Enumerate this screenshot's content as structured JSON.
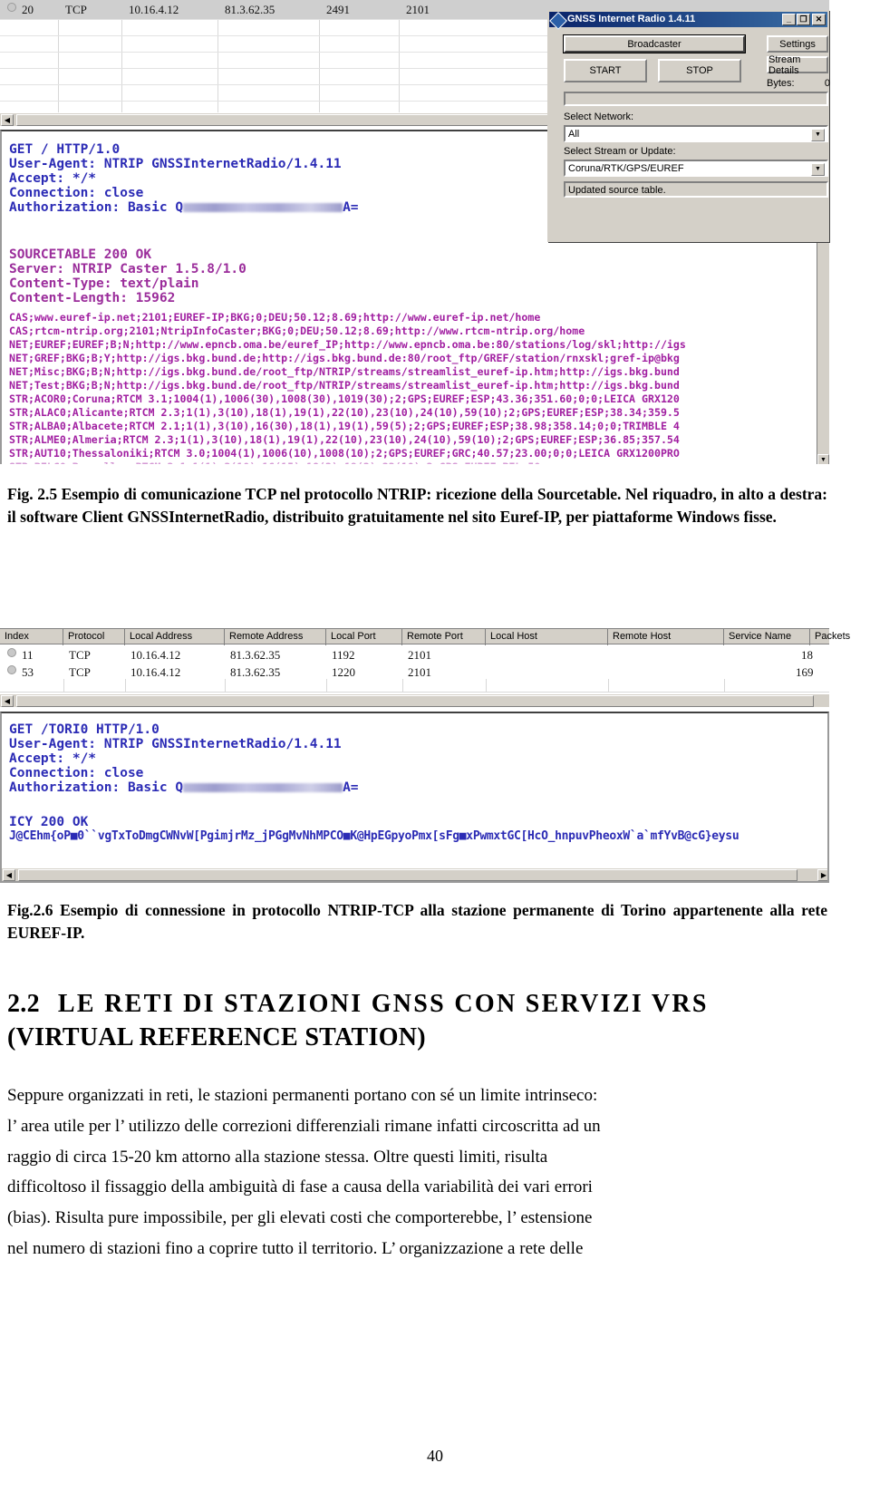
{
  "page": {
    "number": "40"
  },
  "figure1": {
    "connection_row": {
      "index": "20",
      "protocol": "TCP",
      "local_address": "10.16.4.12",
      "remote_address": "81.3.62.35",
      "local_port": "2491",
      "remote_port": "2101"
    },
    "terminal": {
      "request_lines": [
        "GET / HTTP/1.0",
        "User-Agent: NTRIP GNSSInternetRadio/1.4.11",
        "Accept: */*",
        "Connection: close"
      ],
      "auth_prefix": "Authorization: Basic Q",
      "auth_suffix": "A=",
      "response_lines": [
        "SOURCETABLE 200 OK",
        "Server: NTRIP Caster 1.5.8/1.0",
        "Content-Type: text/plain",
        "Content-Length: 15962"
      ],
      "sourcetable_lines": [
        "CAS;www.euref-ip.net;2101;EUREF-IP;BKG;0;DEU;50.12;8.69;http://www.euref-ip.net/home",
        "CAS;rtcm-ntrip.org;2101;NtripInfoCaster;BKG;0;DEU;50.12;8.69;http://www.rtcm-ntrip.org/home",
        "NET;EUREF;EUREF;B;N;http://www.epncb.oma.be/euref_IP;http://www.epncb.oma.be:80/stations/log/skl;http://igs",
        "NET;GREF;BKG;B;Y;http://igs.bkg.bund.de;http://igs.bkg.bund.de:80/root_ftp/GREF/station/rnxskl;gref-ip@bkg",
        "NET;Misc;BKG;B;N;http://igs.bkg.bund.de/root_ftp/NTRIP/streams/streamlist_euref-ip.htm;http://igs.bkg.bund",
        "NET;Test;BKG;B;N;http://igs.bkg.bund.de/root_ftp/NTRIP/streams/streamlist_euref-ip.htm;http://igs.bkg.bund",
        "STR;ACOR0;Coruna;RTCM 3.1;1004(1),1006(30),1008(30),1019(30);2;GPS;EUREF;ESP;43.36;351.60;0;0;LEICA GRX120",
        "STR;ALAC0;Alicante;RTCM 2.3;1(1),3(10),18(1),19(1),22(10),23(10),24(10),59(10);2;GPS;EUREF;ESP;38.34;359.5",
        "STR;ALBA0;Albacete;RTCM 2.1;1(1),3(10),16(30),18(1),19(1),59(5);2;GPS;EUREF;ESP;38.98;358.14;0;0;TRIMBLE 4",
        "STR;ALME0;Almeria;RTCM 2.3;1(1),3(10),18(1),19(1),22(10),23(10),24(10),59(10);2;GPS;EUREF;ESP;36.85;357.54",
        "STR;AUT10;Thessaloniki;RTCM 3.0;1004(1),1006(10),1008(10);2;GPS;EUREF;GRC;40.57;23.00;0;0;LEICA GRX1200PRO"
      ]
    },
    "gnss_window": {
      "title": "GNSS Internet Radio 1.4.11",
      "minimize_label": "_",
      "maximize_label": "❐",
      "close_label": "✕",
      "broadcaster_button": "Broadcaster",
      "settings_button": "Settings",
      "start_button": "START",
      "stop_button": "STOP",
      "stream_details_button": "Stream Details",
      "bytes_label": "Bytes:",
      "bytes_value": "0",
      "select_network_label": "Select Network:",
      "select_network_value": "All",
      "select_stream_label": "Select Stream or Update:",
      "select_stream_value": "Coruna/RTK/GPS/EUREF",
      "status_text": "Updated source table."
    }
  },
  "caption1": "Fig. 2.5 Esempio di comunicazione TCP nel protocollo NTRIP: ricezione della Sourcetable. Nel riquadro, in alto a destra: il software Client GNSSInternetRadio, distribuito gratuitamente nel sito Euref-IP, per piattaforme Windows fisse.",
  "figure2": {
    "columns": [
      "Index",
      "Protocol",
      "Local Address",
      "Remote Address",
      "Local Port",
      "Remote Port",
      "Local Host",
      "Remote Host",
      "Service Name",
      "Packets"
    ],
    "rows": [
      {
        "index": "11",
        "protocol": "TCP",
        "local_address": "10.16.4.12",
        "remote_address": "81.3.62.35",
        "local_port": "1192",
        "remote_port": "2101",
        "local_host": "",
        "remote_host": "",
        "service_name": "",
        "packets": "18"
      },
      {
        "index": "53",
        "protocol": "TCP",
        "local_address": "10.16.4.12",
        "remote_address": "81.3.62.35",
        "local_port": "1220",
        "remote_port": "2101",
        "local_host": "",
        "remote_host": "",
        "service_name": "",
        "packets": "169"
      }
    ],
    "terminal": {
      "request_lines": [
        "GET /TORI0 HTTP/1.0",
        "User-Agent: NTRIP GNSSInternetRadio/1.4.11",
        "Accept: */*",
        "Connection: close"
      ],
      "auth_prefix": "Authorization: Basic Q",
      "auth_suffix": "A=",
      "response_status": "ICY 200 OK",
      "binary_line": "J@CEhm{oP■0``vgTxToDmgCWNvW[PgimjrMz_jPGgMvNhMPCO■K@HpEGpyoPmx[sFg■xPwmxtGC[HcO_hnpuvPheoxW`a`mfYvB@cG}eysu"
    }
  },
  "caption2": "Fig.2.6 Esempio di connessione in protocollo NTRIP-TCP alla stazione permanente di Torino appartenente alla rete EUREF-IP.",
  "section": {
    "number": "2.2",
    "title_line1": "LE RETI DI STAZIONI GNSS CON SERVIZI VRS",
    "title_line2": "(VIRTUAL REFERENCE STATION)"
  },
  "body": {
    "paragraph_lines": [
      "Seppure organizzati in reti, le stazioni permanenti portano con sé un limite intrinseco:",
      "l’ area utile per l’ utilizzo delle correzioni differenziali rimane infatti circoscritta ad un",
      "raggio di circa 15-20 km attorno alla stazione stessa. Oltre questi limiti, risulta",
      "difficoltoso il fissaggio della ambiguità di fase a causa della variabilità dei vari errori",
      "(bias). Risulta pure impossibile, per gli elevati costi che comporterebbe,  l’ estensione",
      "nel numero di stazioni fino a coprire tutto il territorio. L’ organizzazione a rete delle"
    ]
  }
}
